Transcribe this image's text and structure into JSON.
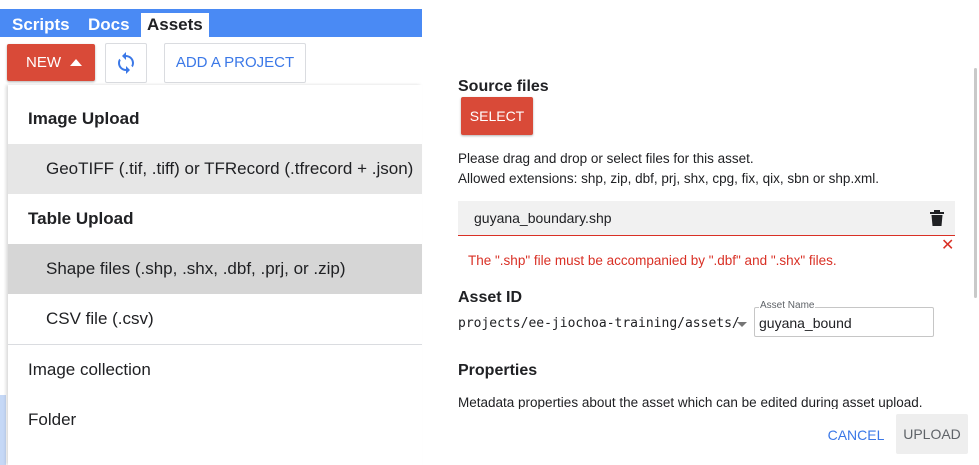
{
  "tabs": [
    {
      "label": "Scripts",
      "active": false
    },
    {
      "label": "Docs",
      "active": false
    },
    {
      "label": "Assets",
      "active": true
    }
  ],
  "toolbar": {
    "new_label": "NEW",
    "refresh_icon": "refresh-icon",
    "add_project_label": "ADD A PROJECT"
  },
  "menu": {
    "image_upload_header": "Image Upload",
    "geotiff": "GeoTIFF (.tif, .tiff) or TFRecord (.tfrecord + .json)",
    "table_upload_header": "Table Upload",
    "shape_files": "Shape files (.shp, .shx, .dbf, .prj, or .zip)",
    "csv_file": "CSV file (.csv)",
    "image_collection": "Image collection",
    "folder": "Folder"
  },
  "dialog": {
    "source_files_title": "Source files",
    "select_label": "SELECT",
    "help_line1": "Please drag and drop or select files for this asset.",
    "help_line2": "Allowed extensions: shp, zip, dbf, prj, shx, cpg, fix, qix, sbn or shp.xml.",
    "file_name": "guyana_boundary.shp",
    "error_message": "The \".shp\" file must be accompanied by \".dbf\" and \".shx\" files.",
    "asset_id_title": "Asset ID",
    "asset_path": "projects/ee-jiochoa-training/assets/",
    "asset_name_label": "Asset Name",
    "asset_name_value": "guyana_bound",
    "properties_title": "Properties",
    "properties_desc": "Metadata properties about the asset which can be edited during asset upload.",
    "cancel_label": "CANCEL",
    "upload_label": "UPLOAD"
  },
  "colors": {
    "tab_bar": "#4a8af4",
    "primary_red": "#d94a38",
    "link_blue": "#3b78e7",
    "error_red": "#d93025"
  }
}
